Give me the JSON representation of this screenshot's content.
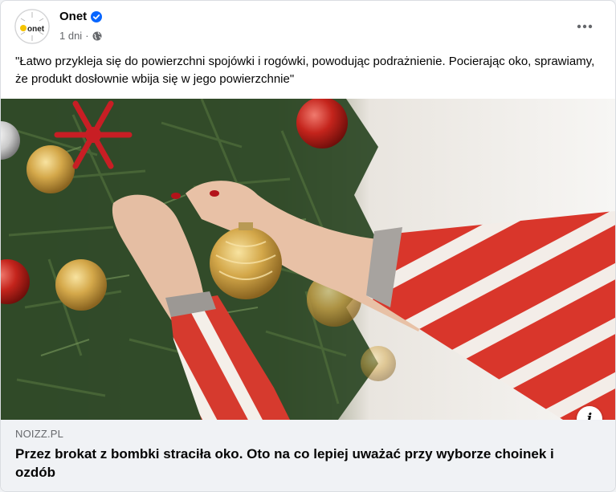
{
  "post": {
    "author": "Onet",
    "avatar_text": "onet",
    "time": "1 dni",
    "separator": "·",
    "privacy_icon": "globe-icon",
    "verified_icon": "verified-badge-icon",
    "more_icon": "more-options-icon",
    "text": "\"Łatwo przykleja się do powierzchni spojówki i rogówki, powodując podrażnienie. Pocierając oko, sprawiamy, że produkt dosłownie wbija się w jego powierzchnie\""
  },
  "link": {
    "domain": "NOIZZ.PL",
    "headline": "Przez brokat z bombki straciła oko. Oto na co lepiej uważać przy wyborze choinek i ozdób",
    "info_symbol": "i"
  },
  "colors": {
    "verified_blue": "#0866ff",
    "onet_yellow": "#f5c400",
    "sweater_red": "#d9362b",
    "link_bar_bg": "#f0f2f5"
  }
}
